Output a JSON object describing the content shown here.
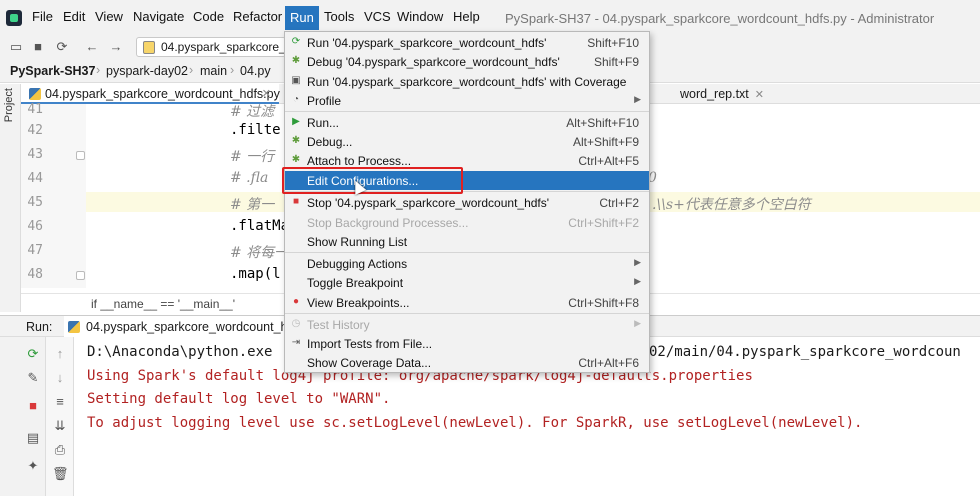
{
  "menubar": {
    "items": [
      "File",
      "Edit",
      "View",
      "Navigate",
      "Code",
      "Refactor",
      "Run",
      "Tools",
      "VCS",
      "Window",
      "Help"
    ],
    "window_title": "PySpark-SH37 - 04.pyspark_sparkcore_wordcount_hdfs.py - Administrator"
  },
  "toolbar": {
    "file_chip": "04.pyspark_sparkcore_w"
  },
  "breadcrumb": [
    "PySpark-SH37",
    "pyspark-day02",
    "main",
    "04.py"
  ],
  "left_strip": {
    "label": "Project"
  },
  "editor_tabs": {
    "active": "04.pyspark_sparkcore_wordcount_hdfs.py",
    "right": "word_rep.txt"
  },
  "editor": {
    "lines": [
      {
        "no": "41",
        "kind": "comment",
        "text": "# 过滤"
      },
      {
        "no": "42",
        "kind": "code",
        "text": ".filte"
      },
      {
        "no": "43",
        "kind": "comment",
        "text": "# 一行"
      },
      {
        "no": "44",
        "kind": "comment",
        "text": "# .fla"
      },
      {
        "no": "45",
        "kind": "comment",
        "text": "# 第一"
      },
      {
        "no": "46",
        "kind": "code",
        "text": ".flatMa"
      },
      {
        "no": "47",
        "kind": "comment",
        "text": "# 将每一"
      },
      {
        "no": "48",
        "kind": "code",
        "text": ".map(l"
      }
    ],
    "line44_tail": "0",
    "line45_tail": ".\\\\s+代表任意多个空白符",
    "structure_crumb": "if __name__ == '__main__'"
  },
  "run_panel": {
    "label": "Run:",
    "tab": "04.pyspark_sparkcore_wordcount_hdfs",
    "console": [
      {
        "text": "D:\\Anaconda\\python.exe",
        "color": "#1a1a1a"
      },
      {
        "text": "Using Spark's default log4j profile: org/apache/spark/log4j-defaults.properties",
        "color": "#b22222"
      },
      {
        "text": "Setting default log level to \"WARN\".",
        "color": "#b22222"
      },
      {
        "text": "To adjust logging level use sc.setLogLevel(newLevel). For SparkR, use setLogLevel(newLevel).",
        "color": "#b22222"
      }
    ],
    "console_tail": "02/main/04.pyspark_sparkcore_wordcoun"
  },
  "run_menu": {
    "items": [
      {
        "label": "Run '04.pyspark_sparkcore_wordcount_hdfs'",
        "shortcut": "Shift+F10",
        "icon": "run-icon"
      },
      {
        "label": "Debug '04.pyspark_sparkcore_wordcount_hdfs'",
        "shortcut": "Shift+F9",
        "icon": "debug-icon"
      },
      {
        "label": "Run '04.pyspark_sparkcore_wordcount_hdfs' with Coverage",
        "shortcut": "",
        "icon": "coverage-icon"
      },
      {
        "label": "Profile",
        "shortcut": "",
        "icon": "profile-icon",
        "submenu": true
      },
      {
        "label": "Run...",
        "shortcut": "Alt+Shift+F10",
        "icon": "run-icon"
      },
      {
        "label": "Debug...",
        "shortcut": "Alt+Shift+F9",
        "icon": "debug-icon"
      },
      {
        "label": "Attach to Process...",
        "shortcut": "Ctrl+Alt+F5",
        "icon": "attach-icon"
      },
      {
        "label": "Edit Configurations...",
        "shortcut": "",
        "icon": "",
        "selected": true
      },
      {
        "label": "Stop '04.pyspark_sparkcore_wordcount_hdfs'",
        "shortcut": "Ctrl+F2",
        "icon": "stop-icon"
      },
      {
        "label": "Stop Background Processes...",
        "shortcut": "Ctrl+Shift+F2",
        "icon": "",
        "disabled": true
      },
      {
        "label": "Show Running List",
        "shortcut": "",
        "icon": ""
      },
      {
        "label": "Debugging Actions",
        "shortcut": "",
        "icon": "",
        "submenu": true
      },
      {
        "label": "Toggle Breakpoint",
        "shortcut": "",
        "icon": "",
        "submenu": true
      },
      {
        "label": "View Breakpoints...",
        "shortcut": "Ctrl+Shift+F8",
        "icon": "breakpoints-icon"
      },
      {
        "label": "Test History",
        "shortcut": "",
        "icon": "test-history-icon",
        "disabled": true,
        "submenu": true
      },
      {
        "label": "Import Tests from File...",
        "shortcut": "",
        "icon": "import-icon"
      },
      {
        "label": "Show Coverage Data...",
        "shortcut": "Ctrl+Alt+F6",
        "icon": ""
      }
    ]
  },
  "colors": {
    "menu_active": "#2675bf",
    "highlight_box": "#e02020",
    "console_error": "#b22222",
    "comment": "#8c8c8c"
  }
}
